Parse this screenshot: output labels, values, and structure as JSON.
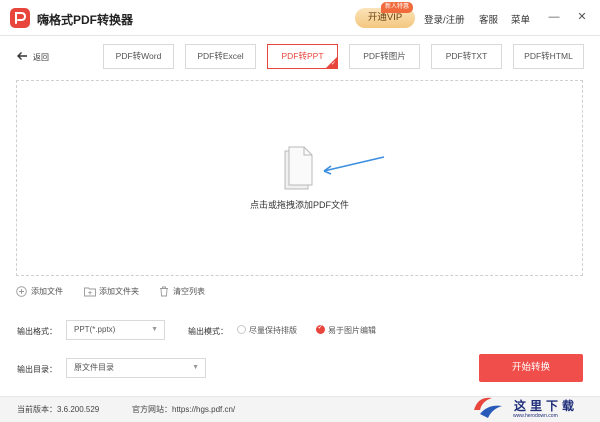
{
  "app": {
    "title": "嗨格式PDF转换器"
  },
  "header": {
    "vip_label": "开通VIP",
    "vip_badge": "新人特惠",
    "login": "登录/注册",
    "service": "客服",
    "menu": "菜单"
  },
  "toolbar": {
    "back": "返回",
    "tabs": [
      {
        "label": "PDF转Word"
      },
      {
        "label": "PDF转Excel"
      },
      {
        "label": "PDF转PPT"
      },
      {
        "label": "PDF转图片"
      },
      {
        "label": "PDF转TXT"
      },
      {
        "label": "PDF转HTML"
      }
    ],
    "active_tab": "PDF转PPT"
  },
  "dropzone": {
    "label": "点击或拖拽添加PDF文件"
  },
  "actions": {
    "add_file": "添加文件",
    "add_folder": "添加文件夹",
    "clear_list": "清空列表"
  },
  "options": {
    "format_label": "输出格式：",
    "format_value": "PPT(*.pptx)",
    "mode_label": "输出模式：",
    "mode_options": [
      {
        "label": "尽量保持排版",
        "selected": false
      },
      {
        "label": "易于图片编辑",
        "selected": true
      }
    ],
    "dir_label": "输出目录：",
    "dir_value": "原文件目录"
  },
  "start_button": "开始转换",
  "footer": {
    "version": "当前版本：3.6.200.529",
    "website": "官方网站：https://hgs.pdf.cn/"
  },
  "watermark": {
    "cn": "这里下载",
    "en": "www.herodown.com"
  },
  "colors": {
    "accent": "#e8453c",
    "start": "#f04e4a",
    "vip": "#f3c77f"
  },
  "icons": [
    "app-logo-icon",
    "back-arrow-icon",
    "pdf-document-icon",
    "add-file-icon",
    "add-folder-icon",
    "trash-icon",
    "minimize-icon",
    "close-icon"
  ]
}
